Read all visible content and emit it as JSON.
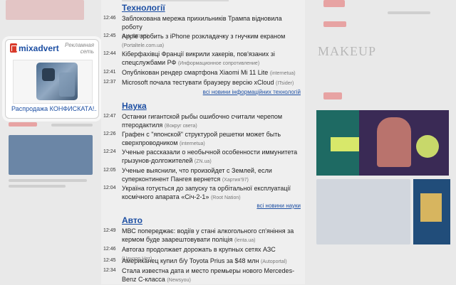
{
  "ad": {
    "brand": "mixadvert",
    "note": "Рекламная сеть",
    "caption": "Распродажа КОНФИСКАТА!..."
  },
  "sections": [
    {
      "title": "Технології",
      "items": [
        {
          "time": "12:46",
          "text": "Заблокована мережа прихильників Трампа відновила роботу",
          "source": "(UA.NEWS)"
        },
        {
          "time": "12:45",
          "text": "Apple зробить з iPhone розкладачку з гнучким екраном",
          "source": "(Portaltele.com.ua)"
        },
        {
          "time": "12:44",
          "text": "Кіберфахівці Франції викрили хакерів, пов'язаних зі спецслужбами РФ",
          "source": "(Информационное сопротивление)"
        },
        {
          "time": "12:41",
          "text": "Опублікован рендер смартфона Xiaomi Mi 11 Lite",
          "source": "(internetua)"
        },
        {
          "time": "12:37",
          "text": "Microsoft почала тестувати браузеру версію xCloud",
          "source": "(ITsider)"
        }
      ],
      "more": "всі новини інформаційних технологій"
    },
    {
      "title": "Наука",
      "items": [
        {
          "time": "12:47",
          "text": "Останки гигантской рыбы ошибочно считали черепом птеродактиля",
          "source": "(Вокруг света)"
        },
        {
          "time": "12:26",
          "text": "Графен с \"японской\" структурой решетки может быть сверхпроводником",
          "source": "(internetua)"
        },
        {
          "time": "12:24",
          "text": "Ученые рассказали о необычной особенности иммунитета грызунов-долгожителей",
          "source": "(ZN.ua)"
        },
        {
          "time": "12:05",
          "text": "Ученые выяснили, что произойдет с Землей, если суперконтинент Пангея вернется",
          "source": "(Хартия'97)"
        },
        {
          "time": "12:04",
          "text": "Україна готується до запуску та орбітальної експлуатації космічного апарата «Січ-2-1»",
          "source": "(Root Nation)"
        }
      ],
      "more": "всі новини науки"
    },
    {
      "title": "Авто",
      "items": [
        {
          "time": "12:49",
          "text": "МВС попереджає: водіїв у стані алкогольного сп'яніння за кермом буде заарештовувати поліція",
          "source": "(lenta.ua)"
        },
        {
          "time": "12:46",
          "text": "Автогаз продолжает дорожать в крупных сетях АЗС",
          "source": "(Цензор.Нет)"
        },
        {
          "time": "12:45",
          "text": "Американец купил б/у Toyota Prius за $48 млн",
          "source": "(Autoportal)"
        },
        {
          "time": "12:34",
          "text": "Стала известна дата и место премьеры нового Mercedes-Benz C-класса",
          "source": "(Newsyou)"
        }
      ],
      "more": ""
    }
  ],
  "right": {
    "makeup_label": "MAKEUP"
  }
}
